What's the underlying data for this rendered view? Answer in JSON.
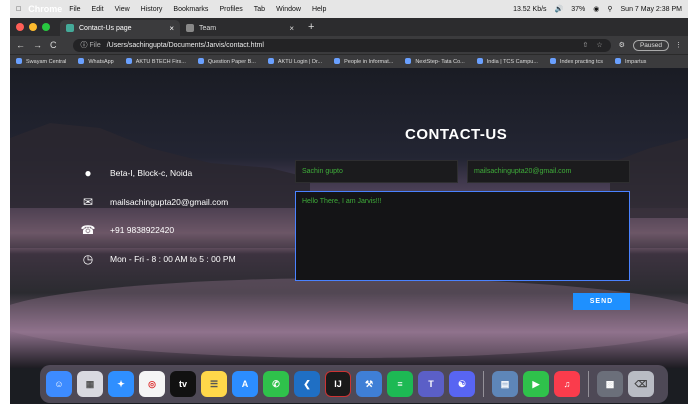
{
  "menubar": {
    "items": [
      "Chrome",
      "File",
      "Edit",
      "View",
      "History",
      "Bookmarks",
      "Profiles",
      "Tab",
      "Window",
      "Help"
    ],
    "clock": "Sun 7 May 2:38 PM",
    "network": "13.52 Kb/s",
    "battery": "37%"
  },
  "browser": {
    "tabs": [
      {
        "title": "Contact-Us page",
        "active": true
      },
      {
        "title": "Team",
        "active": false
      }
    ],
    "url_label": "File",
    "url": "/Users/sachingupta/Documents/Jarvis/contact.html",
    "paused_label": "Paused",
    "bookmarks": [
      "Swayam Central",
      "WhatsApp",
      "AKTU BTECH Firs...",
      "Question Paper B...",
      "AKTU Login | Dr...",
      "People in Informat...",
      "NextStep- Tata Co...",
      "India | TCS Campu...",
      "Index practing tcs",
      "Impartus"
    ]
  },
  "page": {
    "title": "CONTACT-US",
    "info": [
      {
        "icon": "location-icon",
        "text": "Beta-I, Block-c, Noida"
      },
      {
        "icon": "mail-icon",
        "text": "mailsachingupta20@gmail.com"
      },
      {
        "icon": "phone-icon",
        "text": "+91 9838922420"
      },
      {
        "icon": "clock-icon",
        "text": "Mon - Fri - 8 : 00 AM to 5 : 00 PM"
      }
    ],
    "form": {
      "name_value": "Sachin gupto",
      "email_value": "mailsachingupta20@gmail.com",
      "message_value": "Hello There, I am Jarvis!!!",
      "send_label": "SEND"
    }
  },
  "dock": {
    "apps": [
      "Finder",
      "Launchpad",
      "Safari",
      "Chrome",
      "TV",
      "Notes",
      "App Store",
      "WhatsApp",
      "VS Code",
      "IntelliJ",
      "Xcode",
      "Spotify",
      "Teams",
      "Discord",
      "Preview",
      "FaceTime",
      "Music",
      "Keynote",
      "Trash"
    ]
  }
}
